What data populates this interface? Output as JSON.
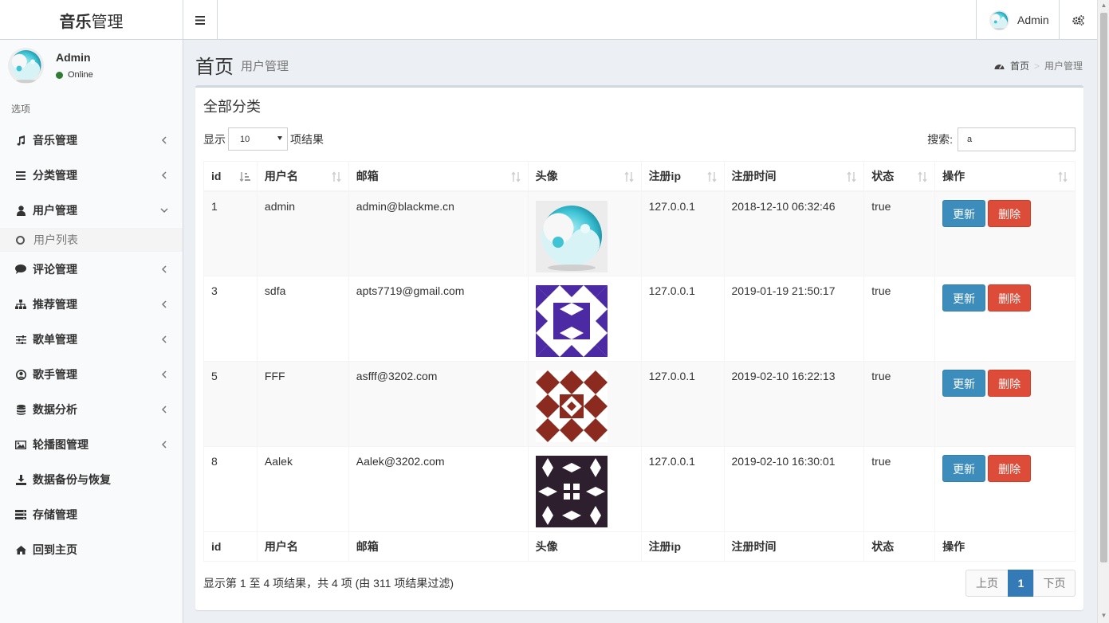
{
  "app": {
    "logo_bold": "音乐",
    "logo_rest": "管理",
    "user_name": "Admin",
    "user_status": "Online"
  },
  "sidebar": {
    "section": "选项",
    "items": [
      {
        "label": "音乐管理",
        "icon": "music-icon",
        "chevron": "left"
      },
      {
        "label": "分类管理",
        "icon": "list-icon",
        "chevron": "left"
      },
      {
        "label": "用户管理",
        "icon": "user-icon",
        "chevron": "down"
      },
      {
        "label": "评论管理",
        "icon": "comment-icon",
        "chevron": "left"
      },
      {
        "label": "推荐管理",
        "icon": "sitemap-icon",
        "chevron": "left"
      },
      {
        "label": "歌单管理",
        "icon": "sliders-icon",
        "chevron": "left"
      },
      {
        "label": "歌手管理",
        "icon": "user-circle-icon",
        "chevron": "left"
      },
      {
        "label": "数据分析",
        "icon": "database-icon",
        "chevron": "left"
      },
      {
        "label": "轮播图管理",
        "icon": "image-icon",
        "chevron": "left"
      },
      {
        "label": "数据备份与恢复",
        "icon": "download-icon",
        "chevron": ""
      },
      {
        "label": "存储管理",
        "icon": "storage-icon",
        "chevron": ""
      },
      {
        "label": "回到主页",
        "icon": "home-icon",
        "chevron": ""
      }
    ],
    "sub_item": "用户列表"
  },
  "header": {
    "title": "首页",
    "subtitle": "用户管理",
    "breadcrumb_home": "首页",
    "breadcrumb_current": "用户管理"
  },
  "box": {
    "title": "全部分类",
    "length_prefix": "显示",
    "length_value": "10",
    "length_suffix": "项结果",
    "search_label": "搜索:",
    "search_value": "a"
  },
  "table": {
    "columns": [
      "id",
      "用户名",
      "邮箱",
      "头像",
      "注册ip",
      "注册时间",
      "状态",
      "操作"
    ],
    "rows": [
      {
        "id": "1",
        "username": "admin",
        "email": "admin@blackme.cn",
        "avatar": "yinyang",
        "ip": "127.0.0.1",
        "time": "2018-12-10 06:32:46",
        "status": "true"
      },
      {
        "id": "3",
        "username": "sdfa",
        "email": "apts7719@gmail.com",
        "avatar": "purple-identicon",
        "ip": "127.0.0.1",
        "time": "2019-01-19 21:50:17",
        "status": "true"
      },
      {
        "id": "5",
        "username": "FFF",
        "email": "asfff@3202.com",
        "avatar": "red-identicon",
        "ip": "127.0.0.1",
        "time": "2019-02-10 16:22:13",
        "status": "true"
      },
      {
        "id": "8",
        "username": "Aalek",
        "email": "Aalek@3202.com",
        "avatar": "dark-identicon",
        "ip": "127.0.0.1",
        "time": "2019-02-10 16:30:01",
        "status": "true"
      }
    ],
    "update_label": "更新",
    "delete_label": "删除"
  },
  "footer": {
    "info": "显示第 1 至 4 项结果，共 4 项 (由 311 项结果过滤)",
    "prev": "上页",
    "current": "1",
    "next": "下页"
  },
  "colors": {
    "primary": "#3c8dbc",
    "danger": "#dd4b39",
    "purple": "#4b2aa3",
    "red": "#8b2a1e",
    "dark": "#2e1f2e"
  }
}
